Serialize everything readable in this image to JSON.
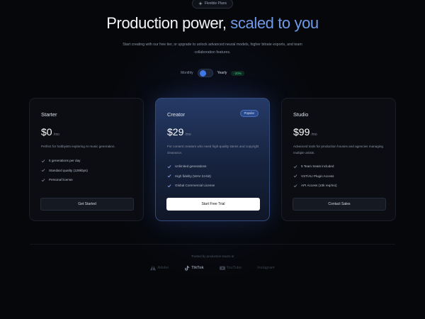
{
  "badge": {
    "label": "Flexible Plans",
    "icon": "sparkle-icon"
  },
  "hero": {
    "title_main": "Production power, ",
    "title_accent": "scaled to you",
    "accent_color": "#6f9ae8",
    "subtitle": "Start creating with our free tier, or upgrade to unlock advanced neural models, higher bitrate exports, and team collaboration features."
  },
  "billing": {
    "monthly_label": "Monthly",
    "yearly_label": "Yearly",
    "discount_label": "-20%",
    "selected": "Yearly"
  },
  "plans": [
    {
      "name": "Starter",
      "price": "$0",
      "period": "/mo",
      "description": "Perfect for hobbyists exploring AI music generation.",
      "features": [
        "5 generations per day",
        "Standard quality (128kbps)",
        "Personal license"
      ],
      "cta": "Get Started"
    },
    {
      "name": "Creator",
      "badge": "Popular",
      "price": "$29",
      "period": "/mo",
      "description": "For content creators who need high-quality stems and copyright clearance.",
      "features": [
        "Unlimited generations",
        "High fidelity (WAV 24-bit)",
        "Global Commercial License"
      ],
      "cta": "Start Free Trial"
    },
    {
      "name": "Studio",
      "price": "$99",
      "period": "/mo",
      "description": "Advanced tools for production houses and agencies managing multiple artists.",
      "features": [
        "5 Team Seats included",
        "VST/AU Plugin Access",
        "API Access (10k req/mo)"
      ],
      "cta": "Contact Sales"
    }
  ],
  "trusted": {
    "label": "Trusted by production teams at",
    "logos": [
      {
        "name": "Adobe",
        "icon": "adobe-icon"
      },
      {
        "name": "TikTok",
        "icon": "tiktok-icon"
      },
      {
        "name": "YouTube",
        "icon": "youtube-icon"
      },
      {
        "name": "Instagram",
        "icon": "instagram-icon"
      }
    ]
  },
  "colors": {
    "background": "#06070a",
    "accent": "#3f78e8",
    "success": "#3ecf8e"
  }
}
